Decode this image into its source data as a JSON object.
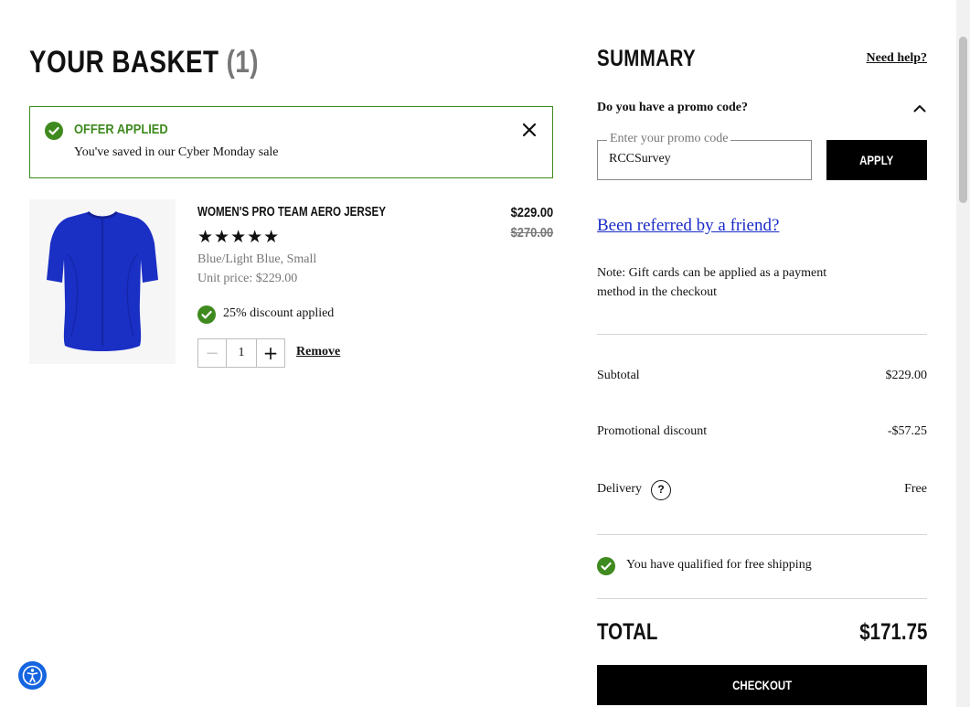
{
  "basket": {
    "title": "YOUR BASKET",
    "count": "(1)"
  },
  "offer": {
    "title": "OFFER APPLIED",
    "text": "You've saved in our Cyber Monday sale"
  },
  "item": {
    "name": "WOMEN'S PRO TEAM AERO JERSEY",
    "rating_stars": "★★★★★",
    "rating": 5,
    "variant": "Blue/Light Blue, Small",
    "unit_price": "Unit price: $229.00",
    "price": "$229.00",
    "original_price": "$270.00",
    "discount_note": "25% discount applied",
    "quantity": "1",
    "minus": "−",
    "plus": "+",
    "remove_label": "Remove",
    "colors": {
      "jersey": "#1a2fc4",
      "jersey_dark": "#13229a"
    }
  },
  "summary": {
    "title": "SUMMARY",
    "need_help": "Need help?",
    "promo_question": "Do you have a promo code?",
    "promo_placeholder": "Enter your promo code",
    "promo_value": "RCCSurvey",
    "apply_label": "APPLY",
    "referred": "Been referred by a friend?",
    "note": "Note: Gift cards can be applied as a payment method in the checkout",
    "subtotal_label": "Subtotal",
    "subtotal_value": "$229.00",
    "discount_label": "Promotional discount",
    "discount_value": "-$57.25",
    "delivery_label": "Delivery",
    "delivery_help": "?",
    "delivery_value": "Free",
    "shipping_note": "You have qualified for free shipping",
    "total_label": "TOTAL",
    "total_value": "$171.75",
    "checkout_label": "CHECKOUT"
  },
  "icons": {
    "offer_status": "check-circle-icon",
    "close": "close-icon",
    "collapse": "chevron-up-icon",
    "help": "question-circle-icon",
    "accessibility": "accessibility-icon"
  },
  "colors": {
    "success": "#3f8a1f",
    "link": "#1a2cc7",
    "primary_button": "#000000",
    "accessibility_button": "#1565e0"
  }
}
